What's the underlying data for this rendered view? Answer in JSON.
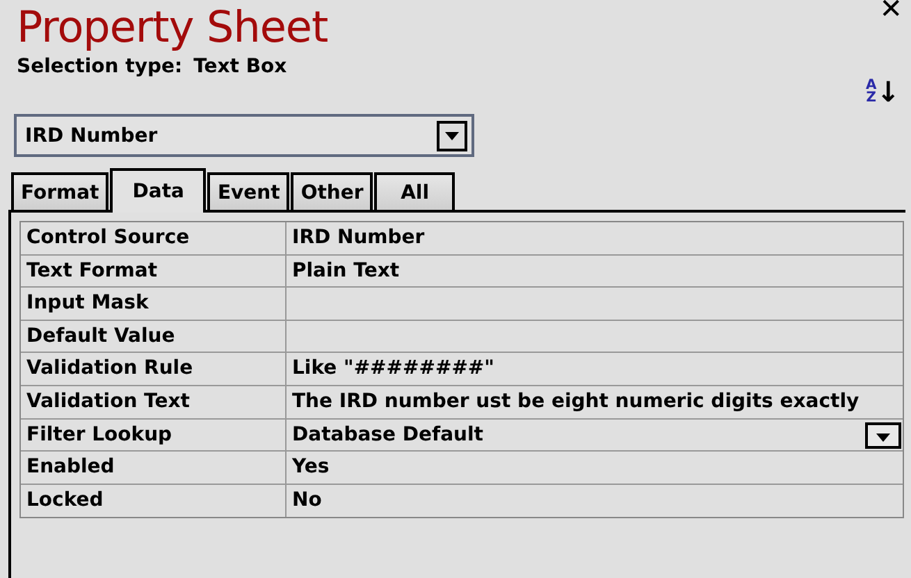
{
  "window": {
    "title": "Property Sheet",
    "close": "✕"
  },
  "selection": {
    "label": "Selection type:",
    "value": "Text Box"
  },
  "sort_button": {
    "top": "A",
    "bottom": "Z",
    "arrow": "↓"
  },
  "object_combo": {
    "value": "IRD Number"
  },
  "tabs": [
    {
      "label": "Format",
      "selected": false
    },
    {
      "label": "Data",
      "selected": true
    },
    {
      "label": "Event",
      "selected": false
    },
    {
      "label": "Other",
      "selected": false
    },
    {
      "label": "All",
      "selected": false
    }
  ],
  "properties": [
    {
      "name": "Control Source",
      "value": "IRD Number",
      "kind": "text"
    },
    {
      "name": "Text Format",
      "value": "Plain Text",
      "kind": "text"
    },
    {
      "name": "Input Mask",
      "kind": "text"
    },
    {
      "name": "Default Value",
      "kind": "text"
    },
    {
      "name": "Validation Rule",
      "value": "Like \"########\"",
      "kind": "text"
    },
    {
      "name": "Validation Text",
      "value": "The IRD number ust be eight numeric digits exactly",
      "kind": "text"
    },
    {
      "name": "Filter Lookup",
      "value": "Database Default",
      "kind": "dropdown"
    },
    {
      "name": "Enabled",
      "value": "Yes",
      "kind": "text"
    },
    {
      "name": "Locked",
      "value": "No",
      "kind": "text"
    }
  ]
}
